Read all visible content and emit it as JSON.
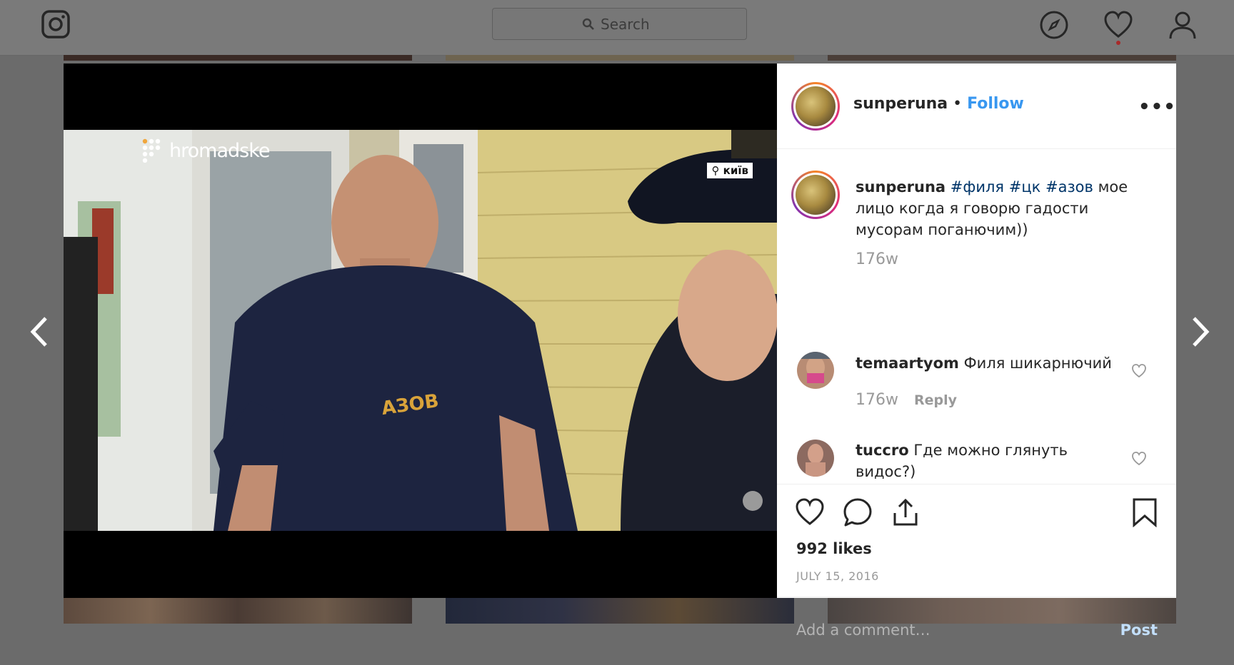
{
  "topbar": {
    "search_placeholder": "Search",
    "icons": [
      "instagram-logo-icon",
      "compass-icon",
      "heart-icon",
      "profile-icon"
    ]
  },
  "video": {
    "brand": "hromadske",
    "location_label": "київ",
    "shirt_text": "АЗОВ"
  },
  "post": {
    "username": "sunperuna",
    "separator": "•",
    "follow_label": "Follow",
    "more_label": "•••",
    "caption": {
      "username": "sunperuna",
      "hashtags": [
        "#филя",
        "#цк",
        "#азов"
      ],
      "text": "мое лицо когда я говорю гадости мусорам поганючим))",
      "time": "176w"
    },
    "comments": [
      {
        "username": "temaartyom",
        "text": "Филя шикарнючий",
        "time": "176w",
        "reply_label": "Reply"
      },
      {
        "username": "tuccro",
        "text": "Где можно глянуть видос?)"
      }
    ],
    "likes": "992 likes",
    "date": "JULY 15, 2016",
    "add_comment_placeholder": "Add a comment…",
    "post_label": "Post"
  },
  "colors": {
    "link_blue": "#3897f0",
    "hashtag_blue": "#003569",
    "overlay": "#6b6b6b"
  }
}
